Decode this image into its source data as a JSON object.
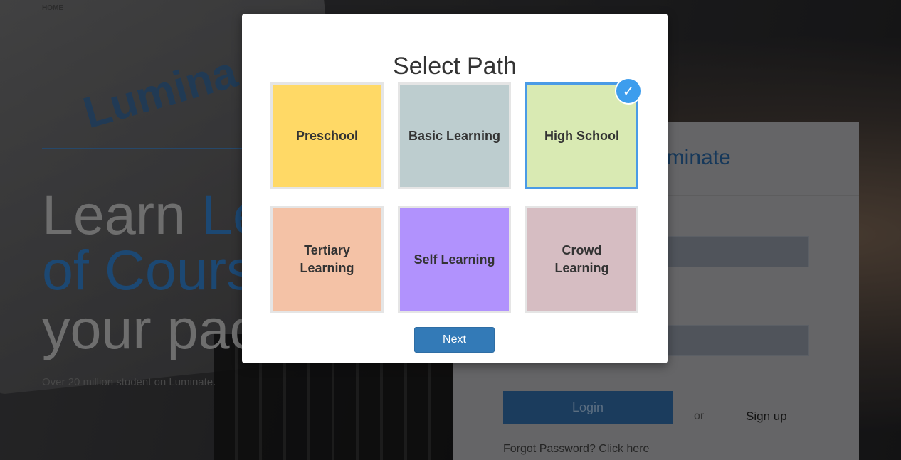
{
  "background": {
    "nav_home": "HOME",
    "logo_text": "Lumina",
    "hero": {
      "line1_a": "Learn ",
      "line1_b": "Le",
      "line2": "of Cours",
      "line3": "your pac",
      "subtitle": "Over 20 million student on Luminate."
    },
    "login": {
      "title": "uminate",
      "login_label": "Login",
      "or_label": "or",
      "signup_label": "Sign up",
      "forgot_label": "Forgot Password? Click here"
    }
  },
  "modal": {
    "title": "Select Path",
    "check_icon": "✓",
    "next_label": "Next",
    "selected": "High School",
    "paths": [
      {
        "label": "Preschool",
        "color": "#ffd966",
        "selected": false
      },
      {
        "label": "Basic Learning",
        "color": "#bdcdcf",
        "selected": false
      },
      {
        "label": "High School",
        "color": "#d9eab3",
        "selected": true
      },
      {
        "label": "Tertiary Learning",
        "color": "#f4c2a6",
        "selected": false
      },
      {
        "label": "Self Learning",
        "color": "#b192fd",
        "selected": false
      },
      {
        "label": "Crowd Learning",
        "color": "#d6bdc2",
        "selected": false
      }
    ]
  }
}
